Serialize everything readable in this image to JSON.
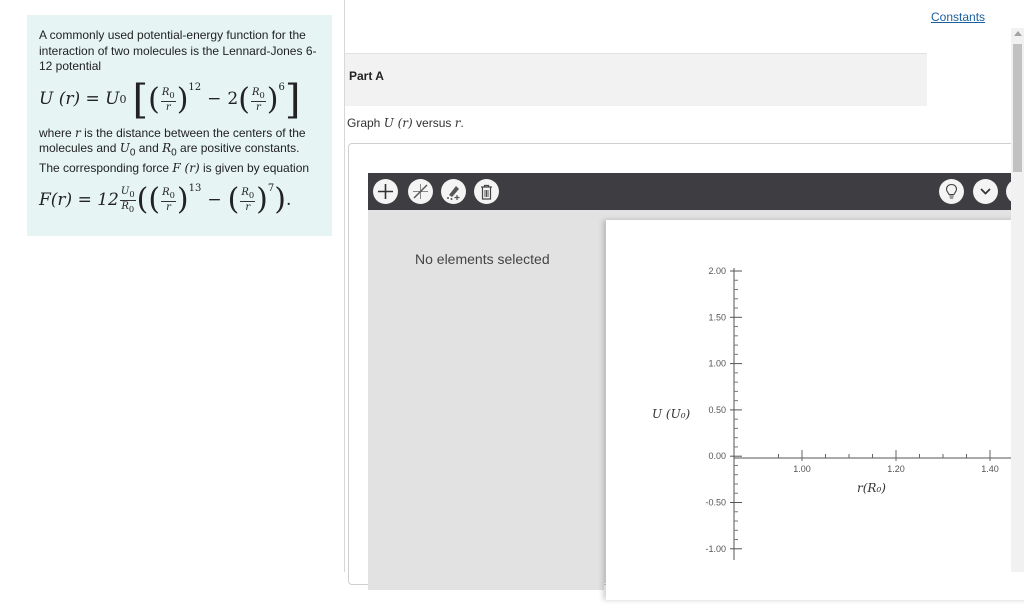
{
  "problem": {
    "intro": "A commonly used potential-energy function for the interaction of two molecules is the Lennard-Jones 6-12 potential",
    "eq1": {
      "lhs": "U (r) = U",
      "lhs_sub": "0",
      "frac_num": "R",
      "frac_num_sub": "0",
      "frac_den": "r",
      "exp1": "12",
      "coef": "2",
      "exp2": "6",
      "minus": "−"
    },
    "where_text_1": "where ",
    "var_r": "r",
    "where_text_2": " is the distance between the centers of the molecules and ",
    "var_u0": "U",
    "var_u0_sub": "0",
    "where_text_3": " and ",
    "var_r0": "R",
    "var_r0_sub": "0",
    "where_text_4": " are positive constants. The corresponding force ",
    "var_fr": "F (r)",
    "where_text_5": " is given by equation",
    "eq2": {
      "lhs": "F(r) = 12",
      "pref_num": "U",
      "pref_num_sub": "0",
      "pref_den": "R",
      "pref_den_sub": "0",
      "exp1": "13",
      "exp2": "7",
      "minus": "−",
      "end": "."
    }
  },
  "header": {
    "constants_link": "Constants"
  },
  "part": {
    "title": "Part A",
    "instruction_1": "Graph ",
    "instruction_math": "U (r)",
    "instruction_2": " versus ",
    "instruction_var": "r",
    "instruction_end": "."
  },
  "graph_tool": {
    "toolbar_icons": [
      "plus-icon",
      "line-tool-icon",
      "draw-function-icon",
      "trash-icon",
      "hint-lightbulb-icon",
      "chevron-down-icon"
    ],
    "side_panel_text": "No elements selected",
    "y_axis_label": "U (U₀)",
    "x_axis_label": "r(R₀)",
    "y_ticks": [
      "2.00",
      "1.50",
      "1.00",
      "0.50",
      "0.00",
      "-0.50",
      "-1.00"
    ],
    "x_ticks": [
      "1.00",
      "1.20",
      "1.40"
    ],
    "colors": {
      "toolbar": "#3e3e42",
      "panel": "#e2e2e2",
      "problem_bg": "#e6f4f4",
      "link": "#1b5f9e"
    }
  }
}
